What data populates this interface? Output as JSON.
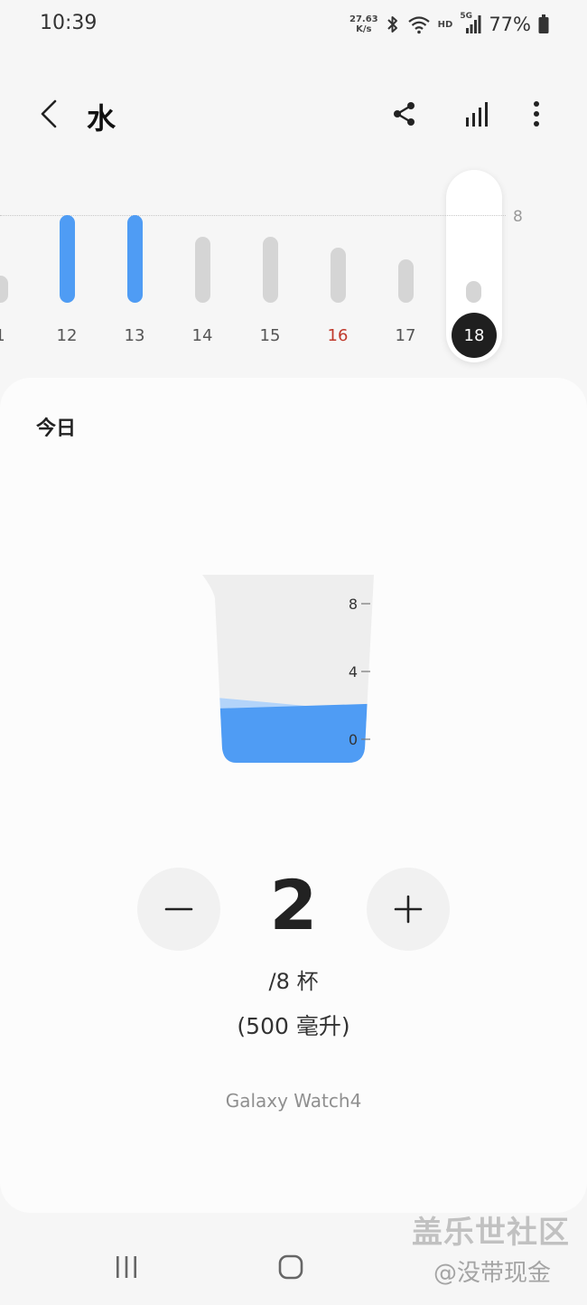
{
  "status_bar": {
    "time": "10:39",
    "net_speed_value": "27.63",
    "net_speed_unit": "K/s",
    "hd_label": "HD",
    "network_label": "5G",
    "battery_percent": "77%",
    "icons": [
      "bluetooth-icon",
      "wifi-icon",
      "signal-icon",
      "battery-icon"
    ]
  },
  "header": {
    "title": "水",
    "icons": [
      "back-icon",
      "share-icon",
      "bar-chart-icon",
      "more-options-icon"
    ]
  },
  "day_strip": {
    "goal_label": "8",
    "accent_color": "#4f9cf4",
    "inactive_color": "#d5d5d5",
    "weekend_color": "#c0392b",
    "days": [
      {
        "label": "1",
        "cups": 2.5,
        "met_goal": false
      },
      {
        "label": "12",
        "cups": 8,
        "met_goal": true
      },
      {
        "label": "13",
        "cups": 8,
        "met_goal": true
      },
      {
        "label": "14",
        "cups": 6,
        "met_goal": false
      },
      {
        "label": "15",
        "cups": 6,
        "met_goal": false
      },
      {
        "label": "16",
        "cups": 5,
        "met_goal": false,
        "weekend": true
      },
      {
        "label": "17",
        "cups": 4,
        "met_goal": false
      },
      {
        "label": "18",
        "cups": 2,
        "met_goal": false,
        "selected": true
      }
    ]
  },
  "today": {
    "label": "今日",
    "cup_ticks": [
      "8",
      "4",
      "0"
    ],
    "cup_fill_cups": 2,
    "cup_max_cups": 8,
    "count": "2",
    "goal_text": "/8 杯",
    "volume_text": "(500 毫升)",
    "device": "Galaxy Watch4",
    "minus_icon": "minus-icon",
    "plus_icon": "plus-icon"
  },
  "nav_bar": {
    "icons": [
      "recent-apps-icon",
      "home-icon"
    ]
  },
  "watermark": {
    "line1": "盖乐世社区",
    "line2": "@没带现金"
  }
}
